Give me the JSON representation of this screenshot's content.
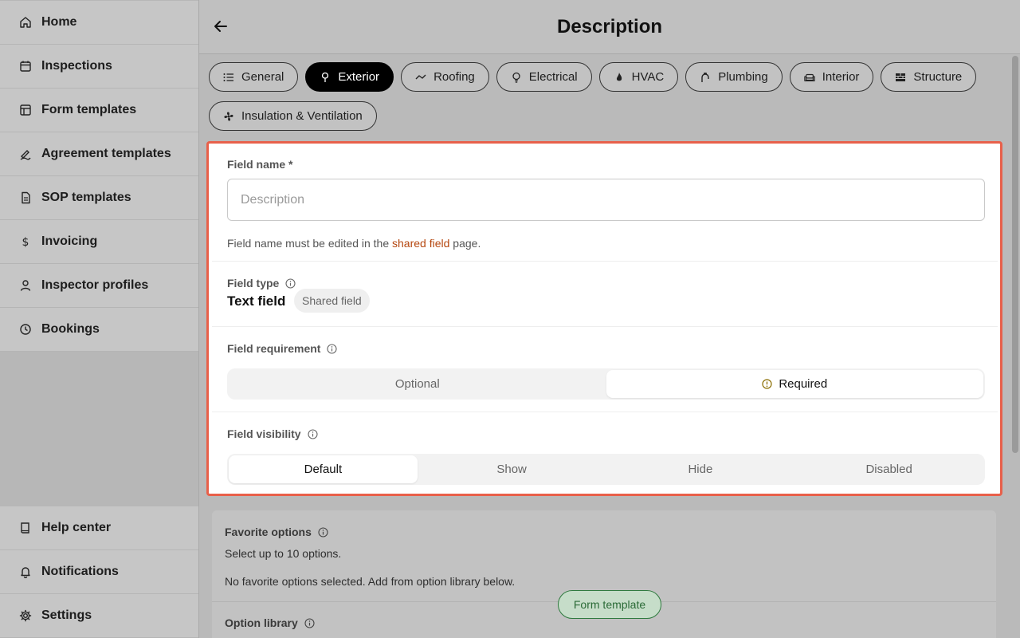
{
  "sidebar": {
    "items": [
      {
        "label": "Home",
        "icon": "home-icon"
      },
      {
        "label": "Inspections",
        "icon": "calendar-icon"
      },
      {
        "label": "Form templates",
        "icon": "layout-icon"
      },
      {
        "label": "Agreement templates",
        "icon": "signature-icon"
      },
      {
        "label": "SOP templates",
        "icon": "document-icon"
      },
      {
        "label": "Invoicing",
        "icon": "dollar-icon"
      },
      {
        "label": "Inspector profiles",
        "icon": "user-icon"
      },
      {
        "label": "Bookings",
        "icon": "clock-icon"
      }
    ],
    "bottom_items": [
      {
        "label": "Help center",
        "icon": "book-icon"
      },
      {
        "label": "Notifications",
        "icon": "bell-icon"
      },
      {
        "label": "Settings",
        "icon": "gear-icon"
      }
    ]
  },
  "header": {
    "title": "Description"
  },
  "tabs": [
    {
      "label": "General",
      "icon": "list-icon"
    },
    {
      "label": "Exterior",
      "icon": "tree-icon",
      "active": true
    },
    {
      "label": "Roofing",
      "icon": "roof-icon"
    },
    {
      "label": "Electrical",
      "icon": "bulb-icon"
    },
    {
      "label": "HVAC",
      "icon": "flame-icon"
    },
    {
      "label": "Plumbing",
      "icon": "faucet-icon"
    },
    {
      "label": "Interior",
      "icon": "sofa-icon"
    },
    {
      "label": "Structure",
      "icon": "brick-icon"
    },
    {
      "label": "Insulation & Ventilation",
      "icon": "fan-icon"
    }
  ],
  "field_name": {
    "label": "Field name *",
    "placeholder": "Description",
    "hint_prefix": "Field name must be edited in the ",
    "hint_link": "shared field",
    "hint_suffix": " page."
  },
  "field_type": {
    "label": "Field type",
    "value": "Text field",
    "badge": "Shared field"
  },
  "field_requirement": {
    "label": "Field requirement",
    "options": [
      "Optional",
      "Required"
    ],
    "selected": "Required"
  },
  "field_visibility": {
    "label": "Field visibility",
    "options": [
      "Default",
      "Show",
      "Hide",
      "Disabled"
    ],
    "selected": "Default"
  },
  "favorite_options": {
    "label": "Favorite options",
    "subtitle": "Select up to 10 options.",
    "empty_text": "No favorite options selected. Add from option library below."
  },
  "option_library": {
    "label": "Option library"
  },
  "floating_pill": {
    "label": "Form template"
  },
  "colors": {
    "highlight": "#e8604a",
    "link": "#b5470f",
    "pill": "#2f7a3f"
  }
}
